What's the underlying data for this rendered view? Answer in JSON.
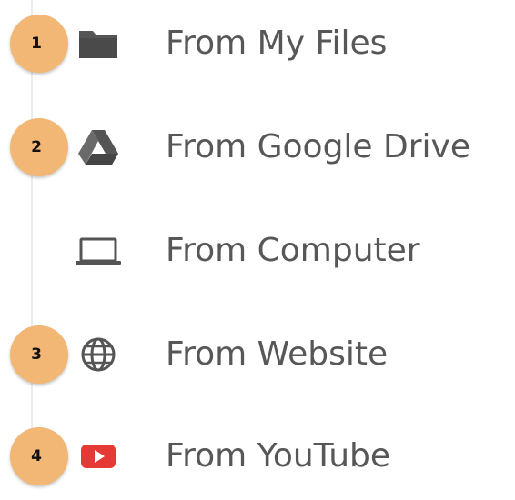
{
  "menu": {
    "items": [
      {
        "label": "From My Files",
        "icon": "folder-icon",
        "badge": "1"
      },
      {
        "label": "From Google Drive",
        "icon": "google-drive-icon",
        "badge": "2"
      },
      {
        "label": "From Computer",
        "icon": "laptop-icon",
        "badge": ""
      },
      {
        "label": "From Website",
        "icon": "globe-icon",
        "badge": "3"
      },
      {
        "label": "From YouTube",
        "icon": "youtube-icon",
        "badge": "4"
      }
    ]
  },
  "colors": {
    "label_text": "#575757",
    "icon_gray": "#555555",
    "badge_fill": "#f2b675",
    "youtube_red": "#e53935"
  }
}
